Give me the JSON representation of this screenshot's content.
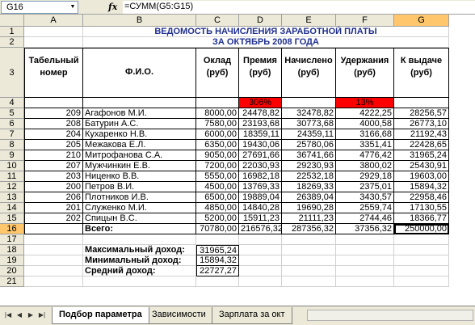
{
  "formula_bar": {
    "name_box": "G16",
    "fx": "fx",
    "formula": "=СУММ(G5:G15)"
  },
  "columns": [
    "A",
    "B",
    "C",
    "D",
    "E",
    "F",
    "G"
  ],
  "rows": [
    "1",
    "2",
    "3",
    "4",
    "5",
    "6",
    "7",
    "8",
    "9",
    "10",
    "11",
    "12",
    "13",
    "14",
    "15",
    "16",
    "17",
    "18",
    "19",
    "20",
    "21"
  ],
  "title1": "ВЕДОМОСТЬ НАЧИСЛЕНИЯ ЗАРАБОТНОЙ ПЛАТЫ",
  "title2": "ЗА ОКТЯБРЬ 2008 ГОДА",
  "headers": {
    "tabnum": "Табельный номер",
    "fio": "Ф.И.О.",
    "oklad": "Оклад (руб)",
    "premia": "Премия (руб)",
    "nachisleno": "Начислено (руб)",
    "uderzh": "Удержания (руб)",
    "k_vydache": "К выдаче (руб)"
  },
  "rates": {
    "premia": "306%",
    "uderzh": "13%"
  },
  "employees": [
    {
      "num": "209",
      "fio": "Агафонов М.И.",
      "oklad": "8000,00",
      "premia": "24478,82",
      "nach": "32478,82",
      "ud": "4222,25",
      "vyd": "28256,57"
    },
    {
      "num": "208",
      "fio": "Батурин А.С.",
      "oklad": "7580,00",
      "premia": "23193,68",
      "nach": "30773,68",
      "ud": "4000,58",
      "vyd": "26773,10"
    },
    {
      "num": "204",
      "fio": "Кухаренко Н.В.",
      "oklad": "6000,00",
      "premia": "18359,11",
      "nach": "24359,11",
      "ud": "3166,68",
      "vyd": "21192,43"
    },
    {
      "num": "205",
      "fio": "Межакова Е.Л.",
      "oklad": "6350,00",
      "premia": "19430,06",
      "nach": "25780,06",
      "ud": "3351,41",
      "vyd": "22428,65"
    },
    {
      "num": "210",
      "fio": "Митрофанова С.А.",
      "oklad": "9050,00",
      "premia": "27691,66",
      "nach": "36741,66",
      "ud": "4776,42",
      "vyd": "31965,24"
    },
    {
      "num": "207",
      "fio": "Мужчинкин Е.В.",
      "oklad": "7200,00",
      "premia": "22030,93",
      "nach": "29230,93",
      "ud": "3800,02",
      "vyd": "25430,91"
    },
    {
      "num": "203",
      "fio": "Ниценко В.В.",
      "oklad": "5550,00",
      "premia": "16982,18",
      "nach": "22532,18",
      "ud": "2929,18",
      "vyd": "19603,00"
    },
    {
      "num": "200",
      "fio": "Петров В.И.",
      "oklad": "4500,00",
      "premia": "13769,33",
      "nach": "18269,33",
      "ud": "2375,01",
      "vyd": "15894,32"
    },
    {
      "num": "206",
      "fio": "Плотников И.В.",
      "oklad": "6500,00",
      "premia": "19889,04",
      "nach": "26389,04",
      "ud": "3430,57",
      "vyd": "22958,46"
    },
    {
      "num": "201",
      "fio": "Служенко М.И.",
      "oklad": "4850,00",
      "premia": "14840,28",
      "nach": "19690,28",
      "ud": "2559,74",
      "vyd": "17130,55"
    },
    {
      "num": "202",
      "fio": "Спицын В.С.",
      "oklad": "5200,00",
      "premia": "15911,23",
      "nach": "21111,23",
      "ud": "2744,46",
      "vyd": "18366,77"
    }
  ],
  "totals": {
    "label": "Всего:",
    "oklad": "70780,00",
    "premia": "216576,32",
    "nach": "287356,32",
    "ud": "37356,32",
    "vyd": "250000,00"
  },
  "stats": [
    {
      "label": "Максимальный доход:",
      "value": "31965,24"
    },
    {
      "label": "Минимальный доход:",
      "value": "15894,32"
    },
    {
      "label": "Средний доход:",
      "value": "22727,27"
    }
  ],
  "tabs": [
    "Подбор параметра",
    "Зависимости",
    "Зарплата за окт"
  ],
  "colors": {
    "accent_title": "#1f2f8f",
    "highlight": "#ff0000",
    "header_bg": "#ece9d8"
  }
}
